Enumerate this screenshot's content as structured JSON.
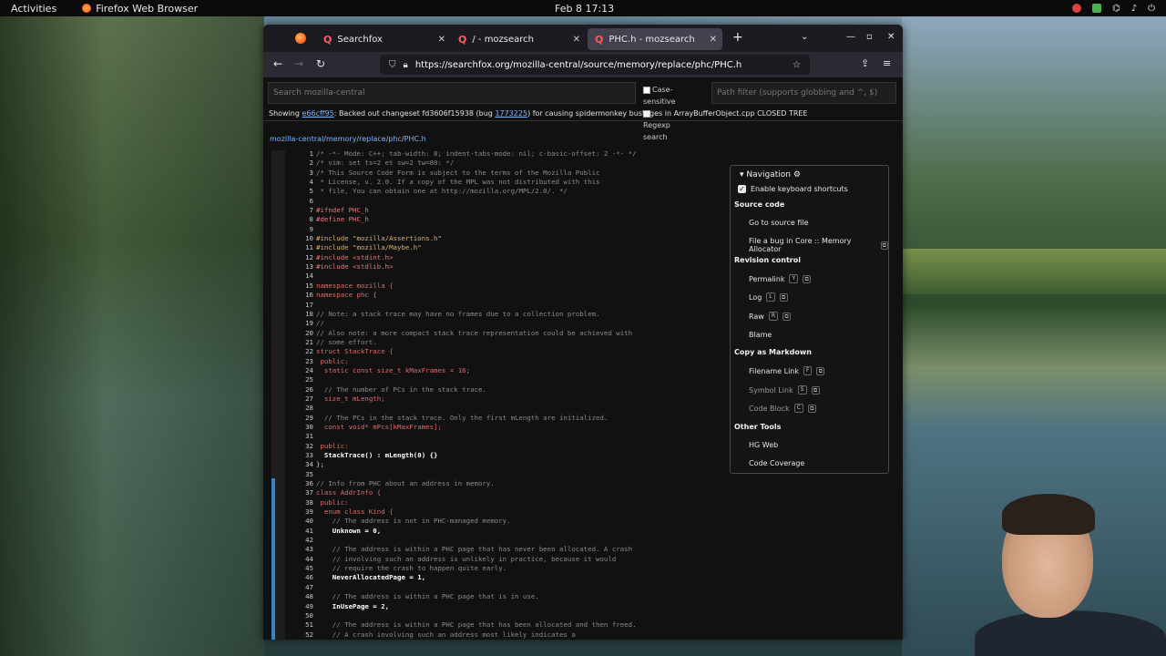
{
  "topbar": {
    "activities": "Activities",
    "app_name": "Firefox Web Browser",
    "clock": "Feb 8  17:13"
  },
  "browser": {
    "tabs": [
      {
        "label": "Searchfox",
        "close": "✕"
      },
      {
        "label": "/ - mozsearch",
        "close": "✕"
      },
      {
        "label": "PHC.h - mozsearch",
        "close": "✕"
      }
    ],
    "new_tab": "+",
    "tab_list": "⌄",
    "url": "https://searchfox.org/mozilla-central/source/memory/replace/phc/PHC.h"
  },
  "search": {
    "placeholder": "Search mozilla-central",
    "case_sensitive": "Case-sensitive",
    "regexp_search": "Regexp search",
    "path_placeholder": "Path filter (supports globbing and ^, $)"
  },
  "banner": {
    "prefix": "Showing ",
    "rev": "e66cff95",
    "text1": ": Backed out changeset fd3606f15938 (bug ",
    "bug": "1773225",
    "text2": ") for causing spidermonkey bustages in ArrayBufferObject.cpp CLOSED TREE"
  },
  "breadcrumbs": [
    "mozilla-central",
    "memory",
    "replace",
    "phc",
    "PHC.h"
  ],
  "navigation": {
    "title": "Navigation",
    "enable_shortcuts": "Enable keyboard shortcuts",
    "source_code": "Source code",
    "go_to_source": "Go to source file",
    "file_bug": "File a bug in Core :: Memory Allocator",
    "revision_control": "Revision control",
    "permalink": "Permalink",
    "permalink_key": "Y",
    "log": "Log",
    "log_key": "L",
    "raw": "Raw",
    "raw_key": "R",
    "blame": "Blame",
    "copy_markdown": "Copy as Markdown",
    "filename_link": "Filename Link",
    "filename_key": "F",
    "symbol_link": "Symbol Link",
    "symbol_key": "S",
    "code_block": "Code Block",
    "code_key": "C",
    "other_tools": "Other Tools",
    "hg_web": "HG Web",
    "code_coverage": "Code Coverage"
  },
  "code_lines": [
    {
      "n": "1",
      "t": "/* -*- Mode: C++; tab-width: 8; indent-tabs-mode: nil; c-basic-offset: 2 -*- */",
      "k": "c-com"
    },
    {
      "n": "2",
      "t": "/* vim: set ts=2 et sw=2 tw=80: */",
      "k": "c-com"
    },
    {
      "n": "3",
      "t": "/* This Source Code Form is subject to the terms of the Mozilla Public",
      "k": "c-com"
    },
    {
      "n": "4",
      "t": " * License, v. 2.0. If a copy of the MPL was not distributed with this",
      "k": "c-com"
    },
    {
      "n": "5",
      "t": " * file, You can obtain one at http://mozilla.org/MPL/2.0/. */",
      "k": "c-com"
    },
    {
      "n": "6",
      "t": "",
      "k": ""
    },
    {
      "n": "7",
      "t": "#ifndef PHC_h",
      "k": "c-pp"
    },
    {
      "n": "8",
      "t": "#define PHC_h",
      "k": "c-pp"
    },
    {
      "n": "9",
      "t": "",
      "k": ""
    },
    {
      "n": "10",
      "t": "#include \"mozilla/Assertions.h\"",
      "k": "c-str"
    },
    {
      "n": "11",
      "t": "#include \"mozilla/Maybe.h\"",
      "k": "c-str"
    },
    {
      "n": "12",
      "t": "#include <stdint.h>",
      "k": "c-pp"
    },
    {
      "n": "13",
      "t": "#include <stdlib.h>",
      "k": "c-pp"
    },
    {
      "n": "14",
      "t": "",
      "k": ""
    },
    {
      "n": "15",
      "t": "namespace mozilla {",
      "k": "c-kw"
    },
    {
      "n": "16",
      "t": "namespace phc {",
      "k": "c-kw"
    },
    {
      "n": "17",
      "t": "",
      "k": ""
    },
    {
      "n": "18",
      "t": "// Note: a stack trace may have no frames due to a collection problem.",
      "k": "c-com"
    },
    {
      "n": "19",
      "t": "//",
      "k": "c-com"
    },
    {
      "n": "20",
      "t": "// Also note: a more compact stack trace representation could be achieved with",
      "k": "c-com"
    },
    {
      "n": "21",
      "t": "// some effort.",
      "k": "c-com"
    },
    {
      "n": "22",
      "t": "struct StackTrace {",
      "k": "c-kw"
    },
    {
      "n": "23",
      "t": " public:",
      "k": "c-kw"
    },
    {
      "n": "24",
      "t": "  static const size_t kMaxFrames = 16;",
      "k": "c-kw"
    },
    {
      "n": "25",
      "t": "",
      "k": ""
    },
    {
      "n": "26",
      "t": "  // The number of PCs in the stack trace.",
      "k": "c-com"
    },
    {
      "n": "27",
      "t": "  size_t mLength;",
      "k": "c-kw"
    },
    {
      "n": "28",
      "t": "",
      "k": ""
    },
    {
      "n": "29",
      "t": "  // The PCs in the stack trace. Only the first mLength are initialized.",
      "k": "c-com"
    },
    {
      "n": "30",
      "t": "  const void* mPcs[kMaxFrames];",
      "k": "c-kw"
    },
    {
      "n": "31",
      "t": "",
      "k": ""
    },
    {
      "n": "32",
      "t": " public:",
      "k": "c-kw"
    },
    {
      "n": "33",
      "t": "  StackTrace() : mLength(0) {}",
      "k": "c-id"
    },
    {
      "n": "34",
      "t": "};",
      "k": ""
    },
    {
      "n": "35",
      "t": "",
      "k": ""
    },
    {
      "n": "36",
      "t": "// Info from PHC about an address in memory.",
      "k": "c-com"
    },
    {
      "n": "37",
      "t": "class AddrInfo {",
      "k": "c-kw"
    },
    {
      "n": "38",
      "t": " public:",
      "k": "c-kw"
    },
    {
      "n": "39",
      "t": "  enum class Kind {",
      "k": "c-kw"
    },
    {
      "n": "40",
      "t": "    // The address is not in PHC-managed memory.",
      "k": "c-com"
    },
    {
      "n": "41",
      "t": "    Unknown = 0,",
      "k": "c-id"
    },
    {
      "n": "42",
      "t": "",
      "k": ""
    },
    {
      "n": "43",
      "t": "    // The address is within a PHC page that has never been allocated. A crash",
      "k": "c-com"
    },
    {
      "n": "44",
      "t": "    // involving such an address is unlikely in practice, because it would",
      "k": "c-com"
    },
    {
      "n": "45",
      "t": "    // require the crash to happen quite early.",
      "k": "c-com"
    },
    {
      "n": "46",
      "t": "    NeverAllocatedPage = 1,",
      "k": "c-id"
    },
    {
      "n": "47",
      "t": "",
      "k": ""
    },
    {
      "n": "48",
      "t": "    // The address is within a PHC page that is in use.",
      "k": "c-com"
    },
    {
      "n": "49",
      "t": "    InUsePage = 2,",
      "k": "c-id"
    },
    {
      "n": "50",
      "t": "",
      "k": ""
    },
    {
      "n": "51",
      "t": "    // The address is within a PHC page that has been allocated and then freed.",
      "k": "c-com"
    },
    {
      "n": "52",
      "t": "    // A crash involving such an address most likely indicates a",
      "k": "c-com"
    }
  ]
}
